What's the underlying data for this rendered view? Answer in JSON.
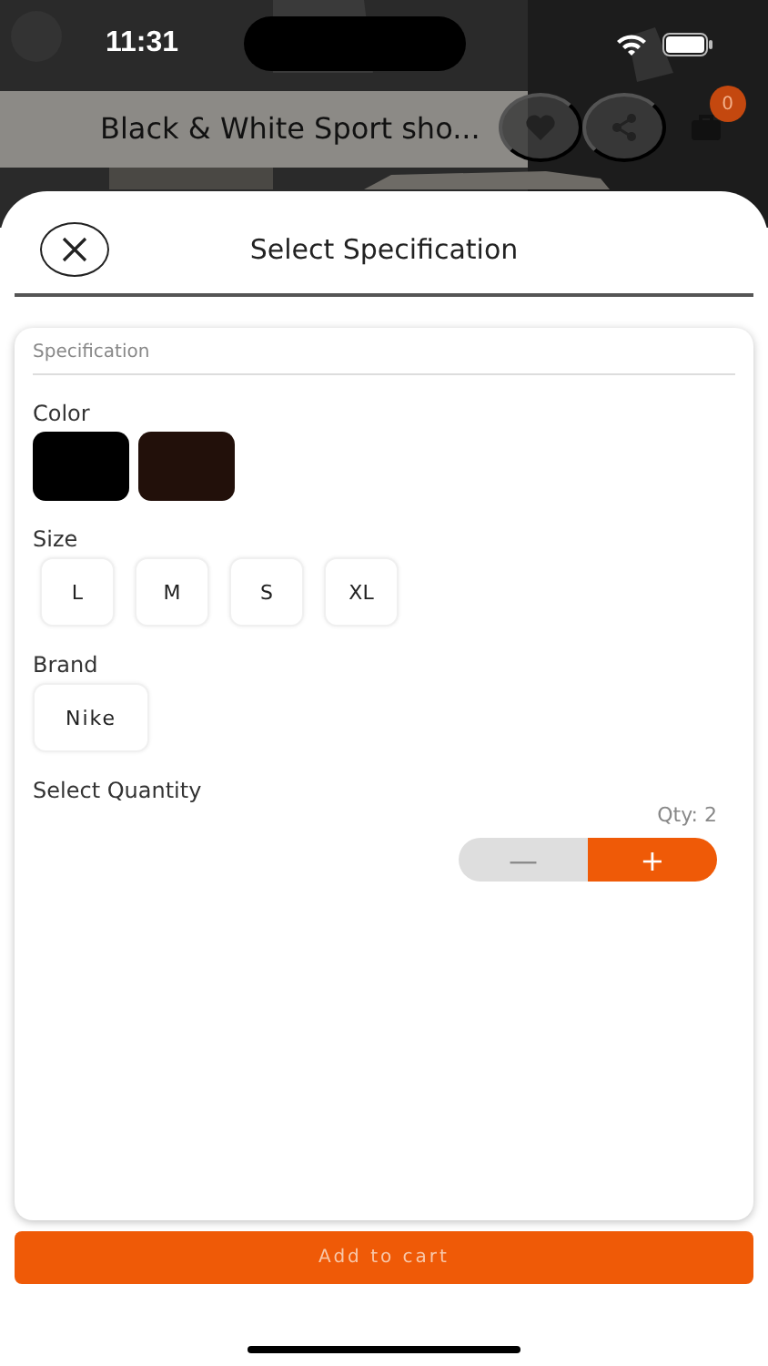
{
  "status_bar": {
    "time": "11:31"
  },
  "product_header": {
    "title": "Black & White Sport sho...",
    "cart_count": "0"
  },
  "sheet": {
    "title": "Select Specification"
  },
  "specification": {
    "heading": "Specification",
    "color": {
      "label": "Color",
      "options": [
        {
          "color": "#000000"
        },
        {
          "color": "#22100a"
        }
      ]
    },
    "size": {
      "label": "Size",
      "options": [
        "L",
        "M",
        "S",
        "XL"
      ]
    },
    "brand": {
      "label": "Brand",
      "options": [
        "Nike"
      ]
    },
    "quantity": {
      "label": "Select Quantity",
      "reading": "Qty: 2",
      "minus": "—",
      "plus": "+"
    }
  },
  "add_to_cart": "Add to cart"
}
